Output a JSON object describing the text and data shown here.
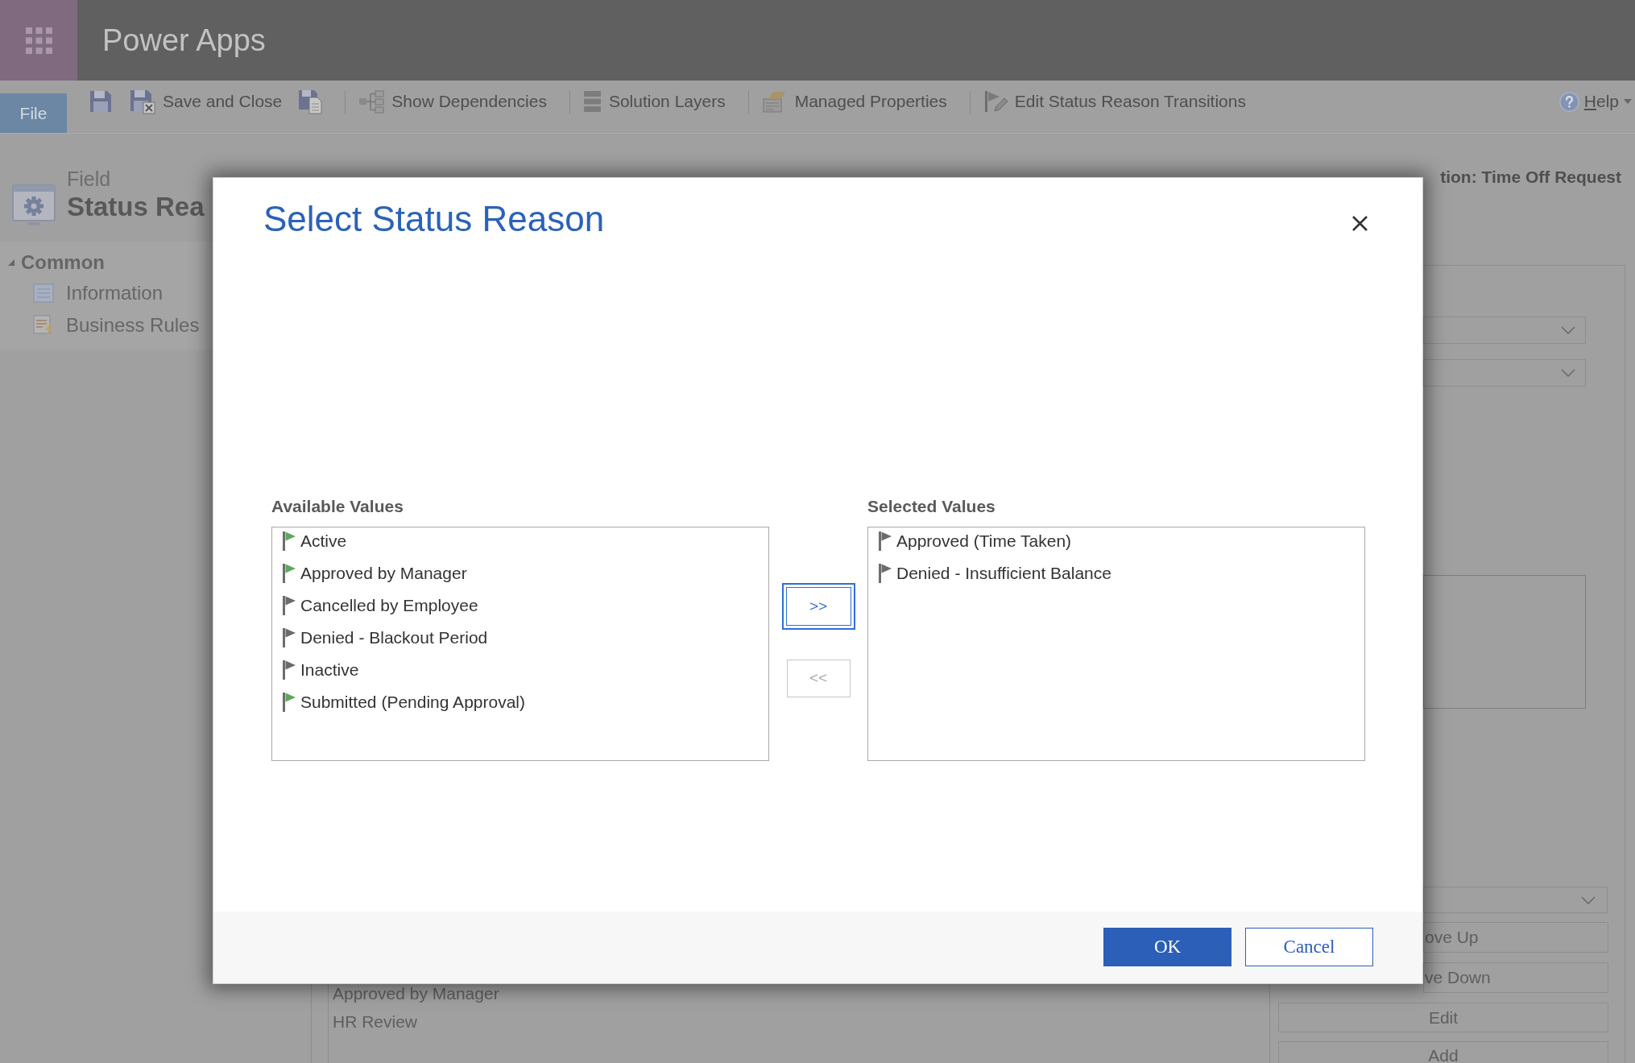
{
  "app_bar": {
    "title": "Power Apps"
  },
  "toolbar": {
    "file_tab": "File",
    "items": [
      {
        "kind": "icon_button"
      },
      {
        "kind": "button",
        "label": "Save and Close"
      },
      {
        "kind": "icon_button"
      },
      {
        "kind": "separator"
      },
      {
        "kind": "button",
        "label": "Show Dependencies"
      },
      {
        "kind": "separator"
      },
      {
        "kind": "button",
        "label": "Solution Layers"
      },
      {
        "kind": "separator"
      },
      {
        "kind": "button",
        "label": "Managed Properties"
      },
      {
        "kind": "separator"
      },
      {
        "kind": "button",
        "label": "Edit Status Reason Transitions"
      }
    ],
    "help": "Help"
  },
  "header": {
    "entity_type": "Field",
    "entity_name": "Status Rea",
    "solution": "tion: Time Off Request"
  },
  "nav": {
    "groups": [
      {
        "label": "Common",
        "expanded": true,
        "children": [
          {
            "label": "Information"
          },
          {
            "label": "Business Rules"
          }
        ]
      }
    ]
  },
  "background_list": {
    "items": [
      "Approved by Manager",
      "HR Review"
    ]
  },
  "side_panel": {
    "controls": [
      {
        "kind": "dropdown"
      },
      {
        "kind": "dropdown"
      },
      {
        "kind": "text_area"
      },
      {
        "kind": "dropdown"
      },
      {
        "kind": "button",
        "label": "ove Up"
      },
      {
        "kind": "button",
        "label": "ve Down"
      },
      {
        "kind": "button",
        "label": "Edit"
      },
      {
        "kind": "button",
        "label": "Add"
      }
    ]
  },
  "dialog": {
    "title": "Select Status Reason",
    "available": {
      "label": "Available Values",
      "items": [
        {
          "label": "Active",
          "color": "#5fa75a",
          "selected": false
        },
        {
          "label": "Approved by Manager",
          "color": "#5fa75a",
          "selected": false
        },
        {
          "label": "Cancelled by Employee",
          "color": "#6b6b6b",
          "selected": false
        },
        {
          "label": "Denied - Blackout Period",
          "color": "#6b6b6b",
          "selected": false
        },
        {
          "label": "Inactive",
          "color": "#6b6b6b",
          "selected": false
        },
        {
          "label": "Submitted (Pending Approval)",
          "color": "#5fa75a",
          "selected": false
        }
      ]
    },
    "move_buttons": [
      {
        "label": ">>",
        "disabled": false,
        "focused": true
      },
      {
        "label": "<<",
        "disabled": true,
        "focused": false
      }
    ],
    "selected": {
      "label": "Selected Values",
      "items": [
        {
          "label": "Approved (Time Taken)",
          "color": "#6b6b6b",
          "selected": false
        },
        {
          "label": "Denied - Insufficient Balance",
          "color": "#6b6b6b",
          "selected": false
        }
      ]
    },
    "buttons": [
      {
        "label": "OK",
        "kind": "primary"
      },
      {
        "label": "Cancel",
        "kind": "secondary"
      }
    ]
  }
}
